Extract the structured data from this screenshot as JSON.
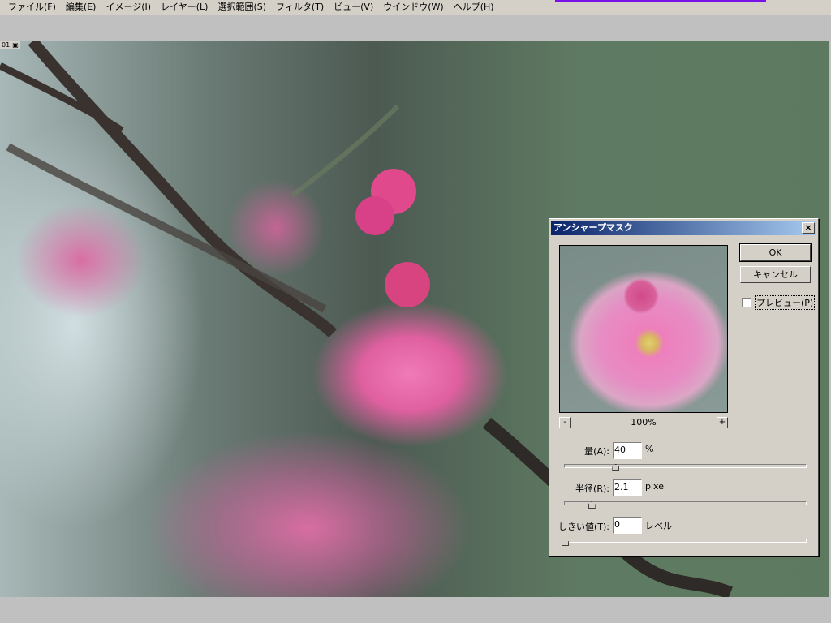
{
  "menu": [
    "ファイル(F)",
    "編集(E)",
    "イメージ(I)",
    "レイヤー(L)",
    "選択範囲(S)",
    "フィルタ(T)",
    "ビュー(V)",
    "ウインドウ(W)",
    "ヘルプ(H)"
  ],
  "document": {
    "tag": "01"
  },
  "dialog": {
    "title": "アンシャープマスク",
    "close": "×",
    "ok": "OK",
    "cancel": "キャンセル",
    "preview_label": "プレビュー(P)",
    "preview_checked": false,
    "zoom_minus": "-",
    "zoom_plus": "+",
    "zoom_level": "100%",
    "amount": {
      "label": "量(A):",
      "value": "40",
      "unit": "%",
      "slider_fraction": 0.21
    },
    "radius": {
      "label": "半径(R):",
      "value": "2.1",
      "unit": "pixel",
      "slider_fraction": 0.11
    },
    "threshold": {
      "label": "しきい値(T):",
      "value": "0",
      "unit": "レベル",
      "slider_fraction": 0.0
    }
  }
}
